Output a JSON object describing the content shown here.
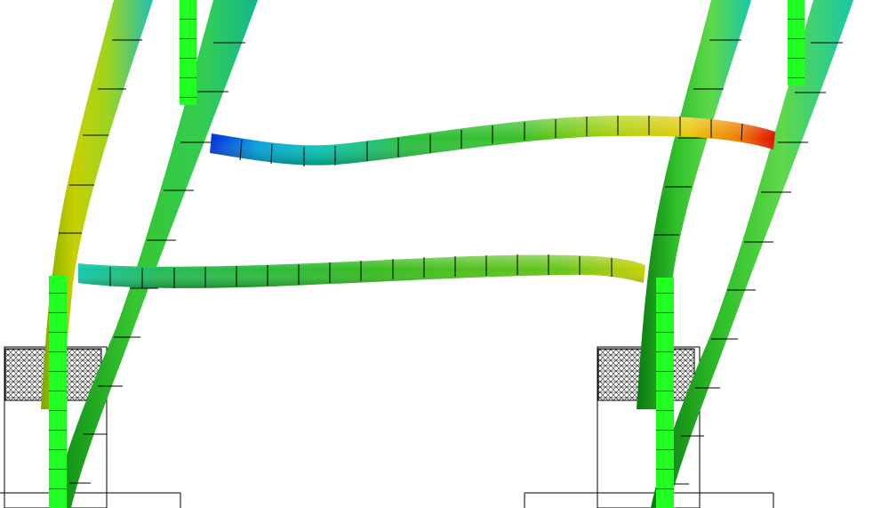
{
  "scene": {
    "background": "#ffffff",
    "colors": {
      "outline": "#000000",
      "blue": "#0044cc",
      "cyan": "#00c8c8",
      "green": "#22bb22",
      "bright_green": "#22ff22",
      "yellow_green": "#b8d400",
      "yellow": "#e8dc00",
      "orange": "#ff8800",
      "red": "#dd1100"
    },
    "elements": [
      "left-pier-left-pile",
      "left-pier-right-pile",
      "right-pier-left-pile",
      "right-pier-right-pile",
      "upper-cross-beam",
      "lower-cross-beam",
      "left-pile-cap",
      "right-pile-cap",
      "segmented-element-strips"
    ]
  }
}
